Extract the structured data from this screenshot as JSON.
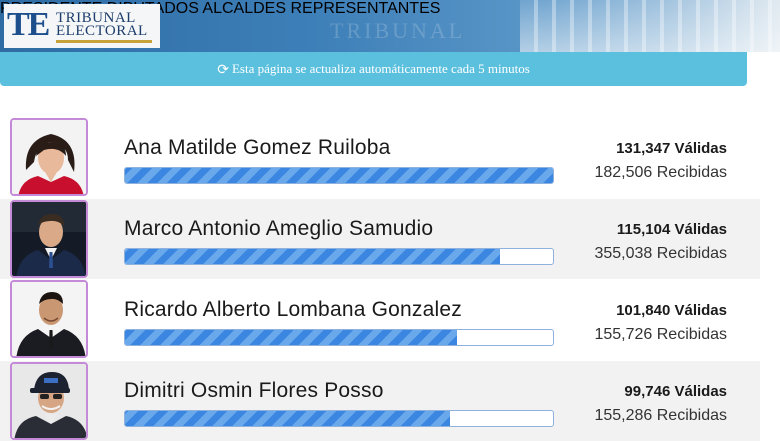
{
  "header": {
    "logo": {
      "mark": "TE",
      "line1": "TRIBUNAL",
      "line2": "ELECTORAL"
    },
    "nav": [
      "PRESIDENTE",
      "DIPUTADOS",
      "ALCALDES",
      "REPRESENTANTES"
    ]
  },
  "banner": {
    "icon": "refresh-icon",
    "text": "Esta página se actualiza automáticamente cada 5 minutos"
  },
  "candidates": [
    {
      "name": "Ana Matilde Gomez Ruiloba",
      "valid": "131,347 Válidas",
      "received": "182,506 Recibidas",
      "progress": 1.0
    },
    {
      "name": "Marco Antonio Ameglio Samudio",
      "valid": "115,104 Válidas",
      "received": "355,038 Recibidas",
      "progress": 0.876
    },
    {
      "name": "Ricardo Alberto Lombana Gonzalez",
      "valid": "101,840 Válidas",
      "received": "155,726 Recibidas",
      "progress": 0.775
    },
    {
      "name": "Dimitri Osmin Flores Posso",
      "valid": "99,746 Válidas",
      "received": "155,286 Recibidas",
      "progress": 0.759
    }
  ],
  "colors": {
    "banner": "#5bc0de",
    "bar": "#3a86e0",
    "avatar_border": "#c48ad8"
  }
}
